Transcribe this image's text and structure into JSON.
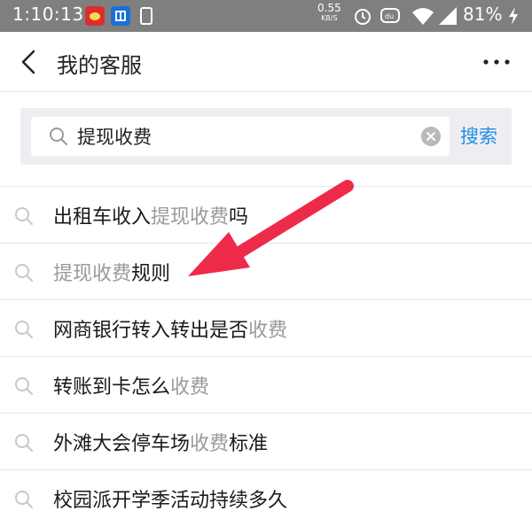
{
  "status_bar": {
    "time": "1:10:13",
    "net_speed_value": "0.55",
    "net_speed_unit": "KB/S",
    "battery_percent": "81%",
    "icons": [
      "weibo-icon",
      "alipay-icon",
      "phone-icon",
      "alarm-icon",
      "speech-icon",
      "wifi-icon",
      "signal-icon",
      "charging-icon"
    ]
  },
  "header": {
    "title": "我的客服",
    "back_icon": "chevron-left-icon",
    "more_icon": "more-dots-icon"
  },
  "search": {
    "value": "提现收费",
    "button_label": "搜索",
    "accent_color": "#1e8ee6"
  },
  "suggestions": [
    {
      "pre": "出租车收入",
      "match": "提现收费",
      "post": "吗"
    },
    {
      "pre": "",
      "match": "提现收费",
      "post": "规则"
    },
    {
      "pre": "网商银行转入转出是否",
      "match": "收费",
      "post": ""
    },
    {
      "pre": "转账到卡怎么",
      "match": "收费",
      "post": ""
    },
    {
      "pre": "外滩大会停车场",
      "match": "收费",
      "post": "标准"
    },
    {
      "pre": "校园派开学季活动持续多久",
      "match": "",
      "post": ""
    }
  ],
  "annotation": {
    "arrow_color": "#ee2a4a"
  }
}
